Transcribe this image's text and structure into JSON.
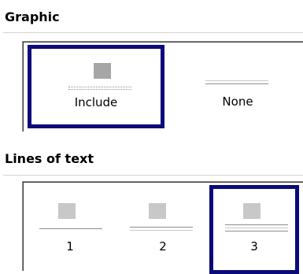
{
  "graphic": {
    "title": "Graphic",
    "options": [
      {
        "label": "Include",
        "selected": true
      },
      {
        "label": "None",
        "selected": false
      }
    ]
  },
  "lines_of_text": {
    "title": "Lines of text",
    "options": [
      {
        "label": "1",
        "selected": false
      },
      {
        "label": "2",
        "selected": false
      },
      {
        "label": "3",
        "selected": true
      }
    ]
  },
  "colors": {
    "selection_border": "#0a0a7a",
    "thumbnail": "#c8c8c8",
    "thumbnail_dark": "#a6a6a6",
    "line": "#8e8e8e",
    "section_rule": "#d7d4c8"
  }
}
